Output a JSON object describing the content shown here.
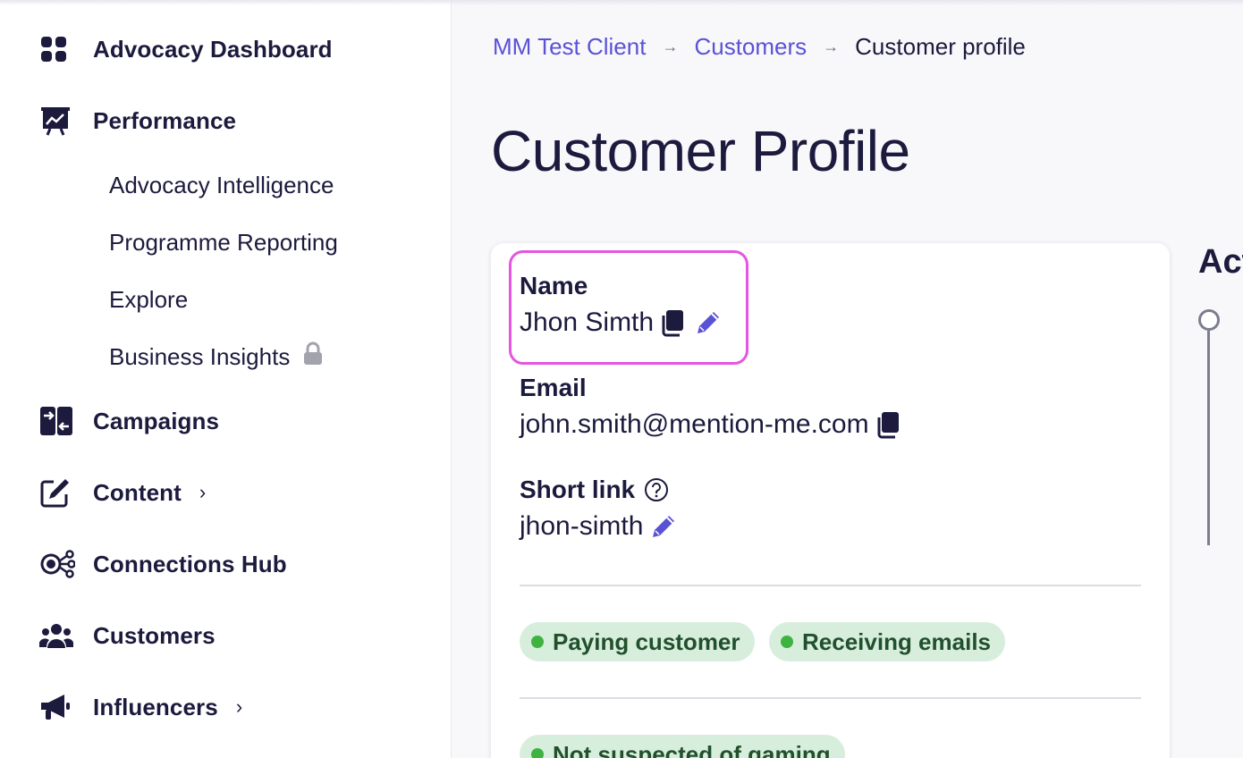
{
  "sidebar": {
    "items": [
      {
        "label": "Advocacy Dashboard",
        "icon": "grid-icon"
      },
      {
        "label": "Performance",
        "icon": "presentation-chart-icon"
      },
      {
        "label": "Campaigns",
        "icon": "arrows-exchange-icon"
      },
      {
        "label": "Content",
        "icon": "edit-icon",
        "chevron": "›"
      },
      {
        "label": "Connections Hub",
        "icon": "network-icon"
      },
      {
        "label": "Customers",
        "icon": "users-icon"
      },
      {
        "label": "Influencers",
        "icon": "megaphone-icon",
        "chevron": "›"
      }
    ],
    "performance_sub": [
      {
        "label": "Advocacy Intelligence"
      },
      {
        "label": "Programme Reporting"
      },
      {
        "label": "Explore"
      },
      {
        "label": "Business Insights",
        "locked": true
      }
    ]
  },
  "breadcrumb": {
    "items": [
      {
        "label": "MM Test Client"
      },
      {
        "label": "Customers"
      },
      {
        "label": "Customer profile"
      }
    ],
    "separator": "→"
  },
  "page": {
    "title": "Customer Profile"
  },
  "profile": {
    "name": {
      "label": "Name",
      "value": "Jhon Simth"
    },
    "email": {
      "label": "Email",
      "value": "john.smith@mention-me.com"
    },
    "short_link": {
      "label": "Short link",
      "value": "jhon-simth"
    },
    "badges": [
      {
        "label": "Paying customer"
      },
      {
        "label": "Receiving emails"
      },
      {
        "label": "Not suspected of gaming"
      }
    ]
  },
  "side_panel": {
    "heading": "Act"
  },
  "colors": {
    "accent": "#5a52d5",
    "text": "#1c1a3d",
    "highlight": "#e555e0",
    "badge_bg": "#d8eedd",
    "badge_dot": "#3fb33f"
  }
}
